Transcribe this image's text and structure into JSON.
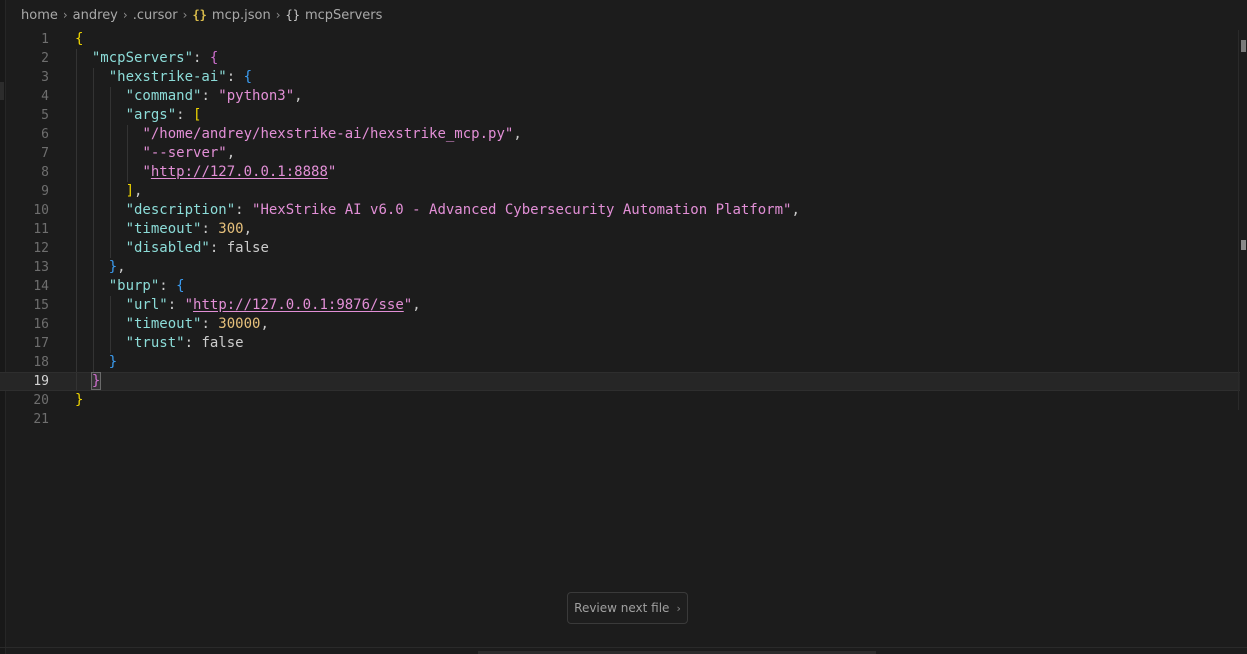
{
  "breadcrumb": {
    "items": [
      "home",
      "andrey",
      ".cursor",
      "mcp.json",
      "mcpServers"
    ],
    "file_icon": "{}",
    "object_icon": "{}"
  },
  "code": {
    "current_line": 19,
    "lines": [
      "{",
      "  \"mcpServers\": {",
      "    \"hexstrike-ai\": {",
      "      \"command\": \"python3\",",
      "      \"args\": [",
      "        \"/home/andrey/hexstrike-ai/hexstrike_mcp.py\",",
      "        \"--server\",",
      "        \"http://127.0.0.1:8888\"",
      "      ],",
      "      \"description\": \"HexStrike AI v6.0 - Advanced Cybersecurity Automation Platform\",",
      "      \"timeout\": 300,",
      "      \"disabled\": false",
      "    },",
      "    \"burp\": {",
      "      \"url\": \"http://127.0.0.1:9876/sse\",",
      "      \"timeout\": 30000,",
      "      \"trust\": false",
      "    }",
      "  }",
      "}",
      ""
    ]
  },
  "review_button": {
    "label": "Review next file",
    "icon": "chevron-right-icon"
  },
  "colors": {
    "background": "#1c1c1c",
    "string": "#e28fd6",
    "number": "#e6c07b",
    "key": "#8cdcd8",
    "bracket_level1": "#f1d700",
    "bracket_level2": "#d070d0",
    "bracket_level3": "#3b9cf0"
  }
}
